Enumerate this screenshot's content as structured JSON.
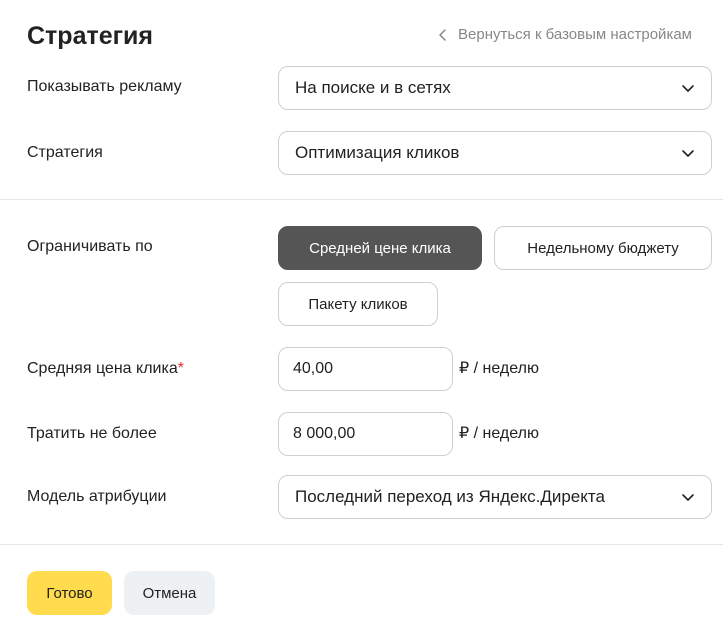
{
  "header": {
    "title": "Стратегия",
    "back_link": "Вернуться к базовым настройкам"
  },
  "show_ads": {
    "label": "Показывать рекламу",
    "value": "На поиске и в сетях"
  },
  "strategy": {
    "label": "Стратегия",
    "value": "Оптимизация кликов"
  },
  "limit_by": {
    "label": "Ограничивать по",
    "options": [
      {
        "label": "Средней цене клика",
        "selected": true
      },
      {
        "label": "Недельному бюджету",
        "selected": false
      },
      {
        "label": "Пакету кликов",
        "selected": false
      }
    ]
  },
  "avg_click_price": {
    "label": "Средняя цена клика",
    "required_mark": "*",
    "value": "40,00",
    "unit": "₽ / неделю"
  },
  "spend_limit": {
    "label": "Тратить не более",
    "value": "8 000,00",
    "unit": "₽ / неделю"
  },
  "attribution": {
    "label": "Модель атрибуции",
    "value": "Последний переход из Яндекс.Директа"
  },
  "footer": {
    "done_label": "Готово",
    "cancel_label": "Отмена"
  },
  "colors": {
    "accent_yellow": "#ffdb4d",
    "active_segment": "#555555",
    "secondary_button": "#eef1f4",
    "required_red": "#e0303a"
  }
}
